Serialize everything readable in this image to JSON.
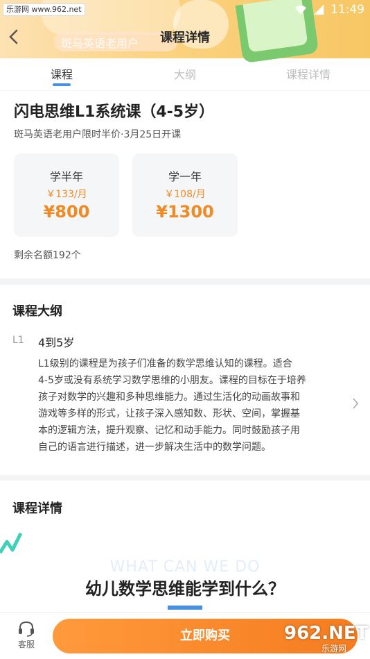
{
  "statusbar": {
    "site": "乐游网 www.962.net",
    "time": "11:49"
  },
  "header": {
    "title": "课程详情",
    "promo_text": "斑马英语老用户"
  },
  "tabs": [
    {
      "label": "课程"
    },
    {
      "label": "大纲"
    },
    {
      "label": "课程详情"
    }
  ],
  "course": {
    "title": "闪电思维L1系统课（4-5岁）",
    "subtitle": "斑马英语老用户限时半价·3月25日开课",
    "plans": [
      {
        "name": "学半年",
        "monthly": "￥133/月",
        "price": "¥800"
      },
      {
        "name": "学一年",
        "monthly": "￥108/月",
        "price": "¥1300"
      }
    ],
    "remaining": "剩余名额192个"
  },
  "outline": {
    "title": "课程大纲",
    "level": "L1",
    "age": "4到5岁",
    "description_lines": [
      "L1级别的课程是为孩子们准备的数学思维认知的课程。适合",
      "4-5岁或没有系统学习数学思维的小朋友。课程的目标在于培养",
      "孩子对数学的兴趣和多种思维能力。通过生活化的动画故事和",
      "游戏等多样的形式，让孩子深入感知数、形状、空间，掌握基",
      "本的逻辑方法，提升观察、记忆和动手能力。同时鼓励孩子用",
      "自己的语言进行描述，进一步解决生活中的数学问题。"
    ]
  },
  "detail": {
    "title": "课程详情",
    "ghost_text": "WHAT CAN WE DO",
    "heading": "幼儿数学思维能学到什么？"
  },
  "bottom": {
    "service_label": "客服",
    "buy_label": "立即购买",
    "watermark_num": "962.NET",
    "watermark_text": "乐游网"
  },
  "colors": {
    "accent_orange": "#f08a24",
    "accent_blue": "#4a90e2",
    "button_orange": "#f57c1f"
  }
}
